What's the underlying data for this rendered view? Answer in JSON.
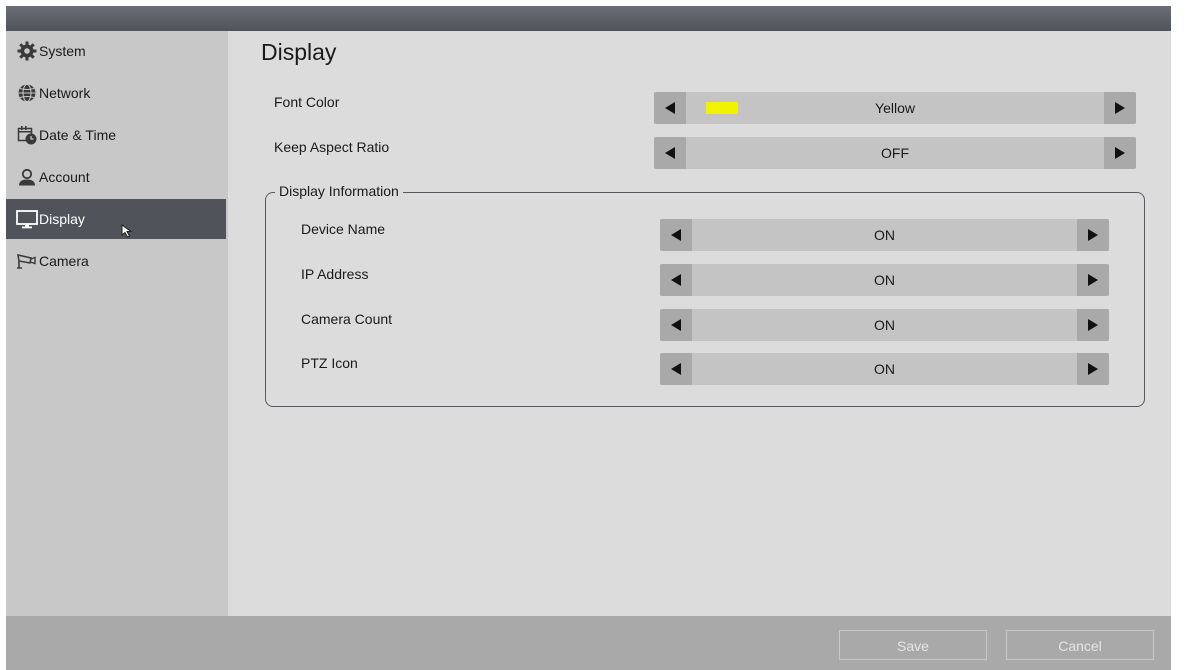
{
  "sidebar": {
    "items": [
      {
        "label": "System",
        "icon": "gear-icon"
      },
      {
        "label": "Network",
        "icon": "globe-icon"
      },
      {
        "label": "Date & Time",
        "icon": "calendar-clock-icon"
      },
      {
        "label": "Account",
        "icon": "user-icon"
      },
      {
        "label": "Display",
        "icon": "monitor-icon",
        "active": true
      },
      {
        "label": "Camera",
        "icon": "camera-icon"
      }
    ]
  },
  "main": {
    "title": "Display",
    "font_color": {
      "label": "Font Color",
      "value": "Yellow",
      "swatch": "#f2f200"
    },
    "keep_aspect_ratio": {
      "label": "Keep Aspect Ratio",
      "value": "OFF"
    },
    "display_information": {
      "title": "Display Information",
      "rows": [
        {
          "label": "Device Name",
          "value": "ON"
        },
        {
          "label": "IP Address",
          "value": "ON"
        },
        {
          "label": "Camera Count",
          "value": "ON"
        },
        {
          "label": "PTZ Icon",
          "value": "ON"
        }
      ]
    }
  },
  "footer": {
    "save_label": "Save",
    "cancel_label": "Cancel"
  },
  "colors": {
    "active_nav": "#50545a",
    "sidebar": "#c8c8c8",
    "content": "#dcdcdc",
    "footer": "#a9a9a9"
  }
}
